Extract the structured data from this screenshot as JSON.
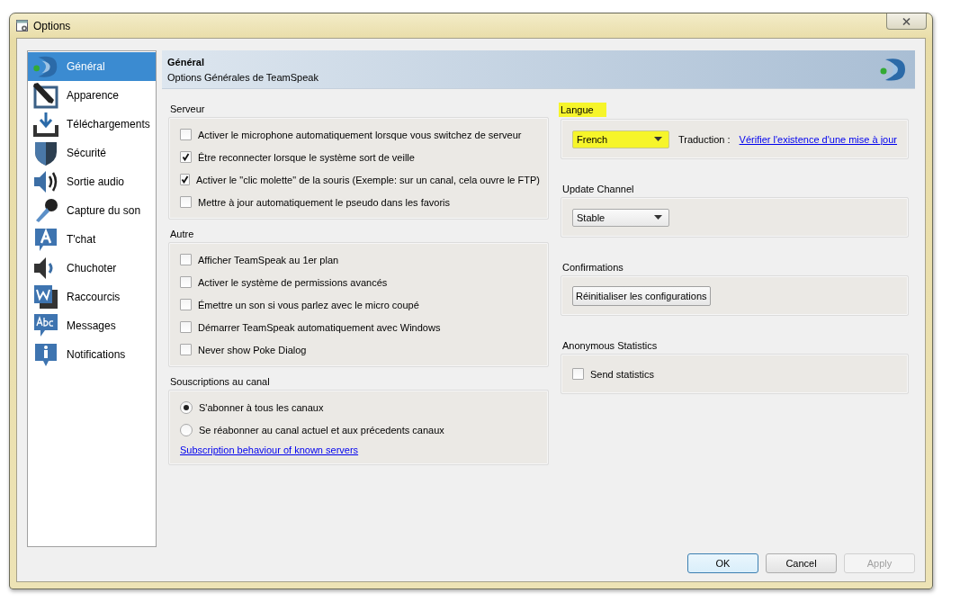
{
  "window": {
    "title": "Options"
  },
  "sidebar": {
    "items": [
      {
        "label": "Général",
        "selected": true
      },
      {
        "label": "Apparence",
        "selected": false
      },
      {
        "label": "Téléchargements",
        "selected": false
      },
      {
        "label": "Sécurité",
        "selected": false
      },
      {
        "label": "Sortie audio",
        "selected": false
      },
      {
        "label": "Capture du son",
        "selected": false
      },
      {
        "label": "T'chat",
        "selected": false
      },
      {
        "label": "Chuchoter",
        "selected": false
      },
      {
        "label": "Raccourcis",
        "selected": false
      },
      {
        "label": "Messages",
        "selected": false
      },
      {
        "label": "Notifications",
        "selected": false
      }
    ]
  },
  "header": {
    "title": "Général",
    "subtitle": "Options Générales de TeamSpeak"
  },
  "left_groups": [
    {
      "title": "Serveur",
      "items": [
        {
          "kind": "checkbox",
          "label": "Activer le microphone automatiquement lorsque vous switchez de serveur",
          "checked": false
        },
        {
          "kind": "checkbox",
          "label": "Être reconnecter lorsque le système sort de veille",
          "checked": true
        },
        {
          "kind": "checkbox",
          "label": "Activer le \"clic molette\" de la souris (Exemple: sur un canal, cela ouvre le FTP)",
          "checked": true
        },
        {
          "kind": "checkbox",
          "label": "Mettre à jour automatiquement le pseudo dans les favoris",
          "checked": false
        }
      ]
    },
    {
      "title": "Autre",
      "items": [
        {
          "kind": "checkbox",
          "label": "Afficher TeamSpeak au 1er plan",
          "checked": false
        },
        {
          "kind": "checkbox",
          "label": "Activer le système de permissions avancés",
          "checked": false
        },
        {
          "kind": "checkbox",
          "label": "Émettre un son si vous parlez avec le micro coupé",
          "checked": false
        },
        {
          "kind": "checkbox",
          "label": "Démarrer TeamSpeak automatiquement avec Windows",
          "checked": false
        },
        {
          "kind": "checkbox",
          "label": "Never show Poke Dialog",
          "checked": false
        }
      ]
    },
    {
      "title": "Souscriptions au canal",
      "items": [
        {
          "kind": "radio",
          "label": "S'abonner à tous les canaux",
          "selected": true
        },
        {
          "kind": "radio",
          "label": "Se réabonner au canal actuel et aux précedents canaux",
          "selected": false
        },
        {
          "kind": "link",
          "label": "Subscription behaviour of known servers"
        }
      ]
    }
  ],
  "right_groups": [
    {
      "title": "Langue",
      "highlighted": true,
      "items": [
        {
          "kind": "combo",
          "value": "French",
          "highlighted": true
        },
        {
          "kind": "text",
          "label": "Traduction :"
        },
        {
          "kind": "link",
          "label": "Vérifier l'existence d'une mise à jour"
        }
      ]
    },
    {
      "title": "Update Channel",
      "highlighted": false,
      "items": [
        {
          "kind": "combo",
          "value": "Stable",
          "highlighted": false
        }
      ]
    },
    {
      "title": "Confirmations",
      "highlighted": false,
      "items": [
        {
          "kind": "button",
          "label": "Réinitialiser les configurations"
        }
      ]
    },
    {
      "title": "Anonymous Statistics",
      "highlighted": false,
      "items": [
        {
          "kind": "checkbox",
          "label": "Send statistics",
          "checked": false
        }
      ]
    }
  ],
  "buttons": [
    {
      "label": "OK",
      "default": true,
      "disabled": false
    },
    {
      "label": "Cancel",
      "default": false,
      "disabled": false
    },
    {
      "label": "Apply",
      "default": false,
      "disabled": true
    }
  ]
}
